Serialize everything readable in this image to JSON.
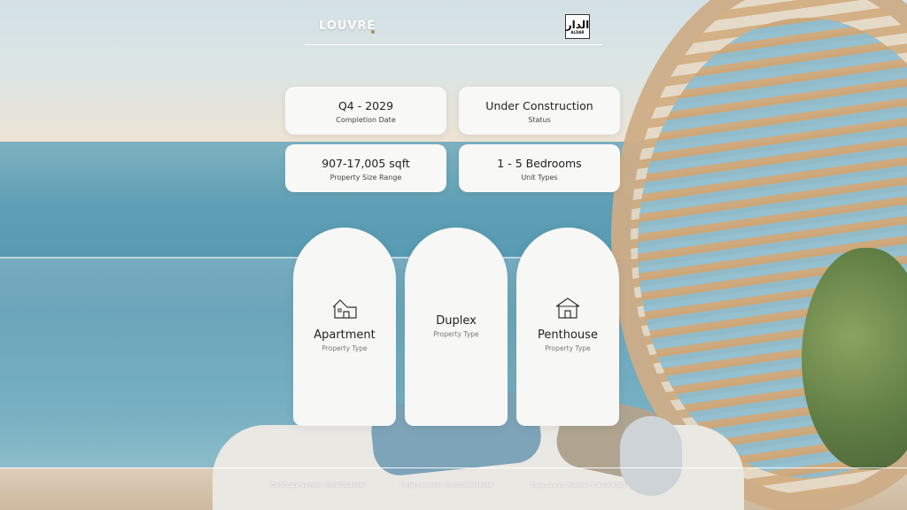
{
  "header": {
    "logo_text": "LOUVRE",
    "brand_name": "ALDAR",
    "brand_mark": "الدار"
  },
  "info_cards": [
    {
      "value": "Q4 - 2029",
      "label": "Completion Date"
    },
    {
      "value": "Under Construction",
      "label": "Status"
    },
    {
      "value": "907-17,005 sqft",
      "label": "Property Size Range"
    },
    {
      "value": "1 - 5 Bedrooms",
      "label": "Unit Types"
    }
  ],
  "property_types": [
    {
      "title": "Apartment",
      "subtitle": "Property Type",
      "icon": "house-icon"
    },
    {
      "title": "Duplex",
      "subtitle": "Property Type",
      "icon": ""
    },
    {
      "title": "Penthouse",
      "subtitle": "Property Type",
      "icon": "villa-icon"
    }
  ],
  "footer": {
    "certificate": "Certificate Number: 202403244080",
    "project": "Project Number: 20250000558588",
    "trade_license": "Trade License Number: CN-5004581"
  }
}
